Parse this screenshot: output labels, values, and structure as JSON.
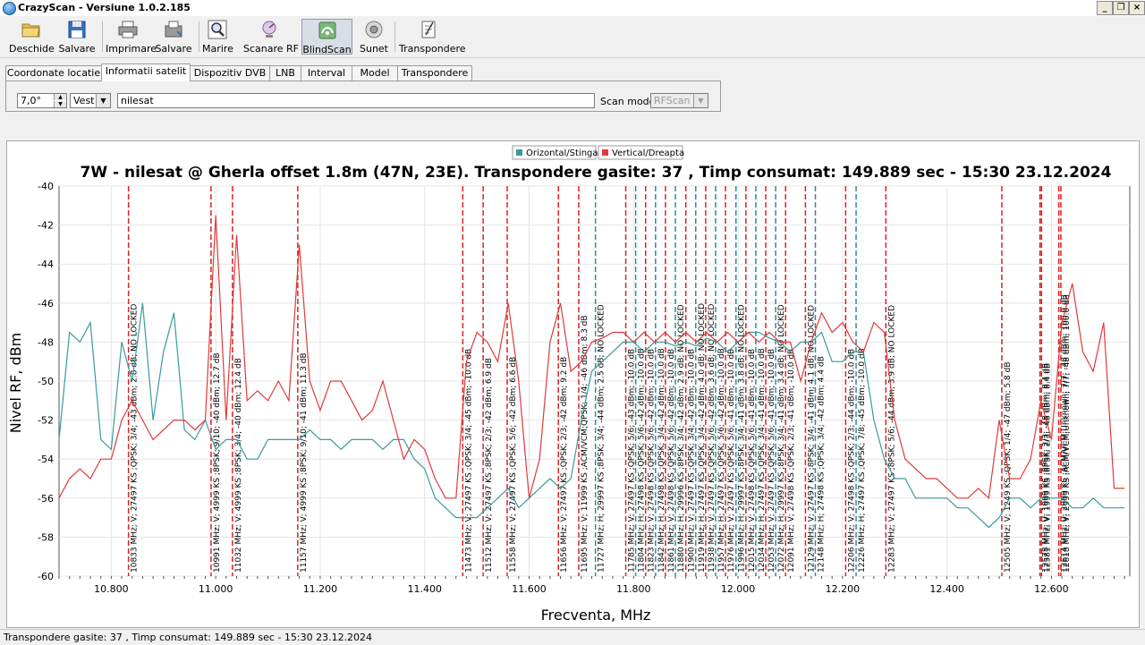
{
  "window": {
    "title": "CrazyScan - Versiune 1.0.2.185"
  },
  "toolbar": {
    "buttons": [
      {
        "label": "Deschide",
        "icon": "folder-icon"
      },
      {
        "label": "Salvare",
        "icon": "floppy-disk-icon"
      },
      {
        "label": "Imprimare",
        "icon": "printer-icon"
      },
      {
        "label": "Salvare",
        "icon": "save-image-icon"
      },
      {
        "label": "Marire",
        "icon": "zoom-icon"
      },
      {
        "label": "Scanare RF",
        "icon": "rf-scan-icon"
      },
      {
        "label": "BlindScan",
        "icon": "blindscan-icon"
      },
      {
        "label": "Sunet",
        "icon": "speaker-icon"
      },
      {
        "label": "Transpondere",
        "icon": "notepad-icon"
      }
    ]
  },
  "tabs": [
    "Coordonate locatie",
    "Informatii satelit",
    "Dispozitiv DVB",
    "LNB",
    "Interval",
    "Model",
    "Transpondere"
  ],
  "active_tab": 1,
  "satellite": {
    "position_value": "7,0°",
    "direction_value": "Vest",
    "name_value": "nilesat",
    "scan_mode_label": "Scan mode",
    "scan_mode_value": "RFScan"
  },
  "status_bar": {
    "text": "Transpondere gasite: 37 , Timp consumat: 149.889 sec - 15:30 23.12.2024"
  },
  "colors": {
    "horizontal": "#3a9a9a",
    "vertical": "#e03a3a",
    "tp_vertical": "#e02020",
    "tp_horizontal": "#2a9090"
  },
  "chart_data": {
    "type": "line",
    "title": "7W - nilesat @ Gherla offset 1.8m (47N, 23E). Transpondere gasite: 37 , Timp consumat: 149.889 sec - 15:30 23.12.2024",
    "xlabel": "Frecventa, MHz",
    "ylabel": "Nivel RF, dBm",
    "xlim": [
      10700,
      12750
    ],
    "ylim": [
      -60,
      -40
    ],
    "x_ticks": [
      "10.800",
      "11.000",
      "11.200",
      "11.400",
      "11.600",
      "11.800",
      "12.000",
      "12.200",
      "12.400",
      "12.600"
    ],
    "x_tick_values": [
      10800,
      11000,
      11200,
      11400,
      11600,
      11800,
      12000,
      12200,
      12400,
      12600
    ],
    "y_ticks": [
      -40,
      -42,
      -44,
      -46,
      -48,
      -50,
      -52,
      -54,
      -56,
      -58,
      -60
    ],
    "grid": true,
    "legend_position": "top-center",
    "series": [
      {
        "name": "Orizontal/Stinga",
        "x": [
          10700,
          10720,
          10740,
          10760,
          10780,
          10800,
          10820,
          10840,
          10860,
          10880,
          10900,
          10920,
          10940,
          10960,
          10980,
          11000,
          11020,
          11040,
          11060,
          11080,
          11100,
          11120,
          11140,
          11160,
          11180,
          11200,
          11220,
          11240,
          11260,
          11280,
          11300,
          11320,
          11340,
          11360,
          11380,
          11400,
          11420,
          11440,
          11460,
          11480,
          11500,
          11520,
          11540,
          11560,
          11580,
          11600,
          11620,
          11640,
          11660,
          11680,
          11700,
          11720,
          11740,
          11760,
          11780,
          11800,
          11820,
          11840,
          11860,
          11880,
          11900,
          11920,
          11940,
          11960,
          11980,
          12000,
          12020,
          12040,
          12060,
          12080,
          12100,
          12120,
          12140,
          12160,
          12180,
          12200,
          12220,
          12240,
          12260,
          12280,
          12300,
          12320,
          12340,
          12360,
          12380,
          12400,
          12420,
          12440,
          12460,
          12480,
          12500,
          12520,
          12540,
          12560,
          12580,
          12600,
          12620,
          12640,
          12660,
          12680,
          12700,
          12720,
          12740
        ],
        "y": [
          -53,
          -47.5,
          -48,
          -47,
          -53,
          -53.5,
          -48,
          -50,
          -46,
          -52,
          -48.5,
          -46.5,
          -52.5,
          -53,
          -52,
          -53.5,
          -53,
          -53,
          -54,
          -54,
          -53,
          -53,
          -53,
          -53,
          -52.5,
          -53,
          -53,
          -53.5,
          -53,
          -53,
          -53,
          -53.5,
          -53,
          -53,
          -54,
          -54.5,
          -56,
          -56.5,
          -57,
          -57,
          -57,
          -56.5,
          -56,
          -55.5,
          -56.5,
          -56,
          -55.5,
          -55,
          -55.5,
          -55,
          -52,
          -49.5,
          -49,
          -48.5,
          -48,
          -48,
          -48.5,
          -48,
          -48,
          -48.2,
          -48,
          -48.2,
          -47.8,
          -48,
          -48.5,
          -48,
          -47.5,
          -47.5,
          -47.8,
          -48,
          -48.5,
          -48,
          -48,
          -47.5,
          -49,
          -49,
          -48.5,
          -48.5,
          -52,
          -54,
          -55,
          -55,
          -56,
          -56,
          -56,
          -56,
          -56.5,
          -56.5,
          -57,
          -57.5,
          -57,
          -56,
          -56,
          -56.5,
          -56,
          -56,
          -56,
          -56.5,
          -56.5,
          -56,
          -56.5,
          -56.5,
          -56.5
        ]
      },
      {
        "name": "Vertical/Dreapta",
        "x": [
          10700,
          10720,
          10740,
          10760,
          10780,
          10800,
          10820,
          10840,
          10860,
          10880,
          10900,
          10920,
          10940,
          10960,
          10980,
          11000,
          11020,
          11040,
          11060,
          11080,
          11100,
          11120,
          11140,
          11160,
          11180,
          11200,
          11220,
          11240,
          11260,
          11280,
          11300,
          11320,
          11340,
          11360,
          11380,
          11400,
          11420,
          11440,
          11460,
          11480,
          11500,
          11520,
          11540,
          11560,
          11580,
          11600,
          11620,
          11640,
          11660,
          11680,
          11700,
          11720,
          11740,
          11760,
          11780,
          11800,
          11820,
          11840,
          11860,
          11880,
          11900,
          11920,
          11940,
          11960,
          11980,
          12000,
          12020,
          12040,
          12060,
          12080,
          12100,
          12120,
          12140,
          12160,
          12180,
          12200,
          12220,
          12240,
          12260,
          12280,
          12300,
          12320,
          12340,
          12360,
          12380,
          12400,
          12420,
          12440,
          12460,
          12480,
          12500,
          12520,
          12540,
          12560,
          12580,
          12600,
          12620,
          12640,
          12660,
          12680,
          12700,
          12720,
          12740
        ],
        "y": [
          -56,
          -55,
          -54.5,
          -55,
          -54,
          -54,
          -52,
          -51,
          -52,
          -53,
          -52.5,
          -52,
          -52,
          -52.5,
          -52,
          -41.5,
          -52,
          -42.5,
          -51,
          -50.5,
          -51,
          -50,
          -51,
          -43,
          -50,
          -51.5,
          -50,
          -50,
          -51,
          -52,
          -51.5,
          -50,
          -52,
          -54,
          -53,
          -53.5,
          -55,
          -56,
          -56,
          -49,
          -47.5,
          -48,
          -49,
          -46,
          -50,
          -56,
          -54,
          -48,
          -46,
          -49.5,
          -49,
          -48,
          -47.8,
          -47.5,
          -47.5,
          -48,
          -47.5,
          -48,
          -47.5,
          -48,
          -47.5,
          -48,
          -47.5,
          -48,
          -47.5,
          -48,
          -47.5,
          -48,
          -47.5,
          -48,
          -48,
          -50,
          -48,
          -46.5,
          -47.5,
          -47,
          -48,
          -48.5,
          -47,
          -47.5,
          -52,
          -54,
          -54.5,
          -55,
          -55,
          -55.5,
          -56,
          -56,
          -55.5,
          -56,
          -52,
          -55,
          -55,
          -54,
          -51,
          -53,
          -47,
          -45,
          -48.5,
          -49.5,
          -47,
          -55.5,
          -55.5
        ]
      }
    ],
    "transponders": [
      {
        "freq": 10833,
        "pol": "V",
        "label": "10833 MHz; V; 27497 KS ;QPSK; 3/4; -43 dBm; 2.8 dB; NO LOCKED"
      },
      {
        "freq": 10991,
        "pol": "V",
        "label": "10991 MHz; V; 4999 KS ;8PSK; 9/10; -40 dBm; 12.7 dB"
      },
      {
        "freq": 11032,
        "pol": "V",
        "label": "11032 MHz; V; 4999 KS ;8PSK; 3/4; -40 dBm; 12.4 dB"
      },
      {
        "freq": 11157,
        "pol": "V",
        "label": "11157 MHz; V; 4999 KS ;8PSK; 9/10; -41 dBm; 11.3 dB"
      },
      {
        "freq": 11473,
        "pol": "V",
        "label": "11473 MHz; V; 27497 KS ;QPSK; 3/4; -45 dBm; -10.0 dB"
      },
      {
        "freq": 11512,
        "pol": "V",
        "label": "11512 MHz; V; 27497 KS ;8PSK; 2/3; -42 dBm; 6.9 dB"
      },
      {
        "freq": 11558,
        "pol": "V",
        "label": "11558 MHz; V; 27497 KS ;QPSK; 5/6; -42 dBm; 6.6 dB"
      },
      {
        "freq": 11656,
        "pol": "V",
        "label": "11656 MHz; V; 27497 KS ;QPSK; 2/3; -42 dBm; 9.2 dB"
      },
      {
        "freq": 11695,
        "pol": "V",
        "label": "11695 MHz; V; 11999 KS ;ACM/VCM;QPSK; 1/4; -46 dBm; 8.3 dB"
      },
      {
        "freq": 11727,
        "pol": "H",
        "label": "11727 MHz; H; 29997 KS ;8PSK; 3/4; -44 dBm; 2.5 dB; NO LOCKED"
      },
      {
        "freq": 11785,
        "pol": "V",
        "label": "11785 MHz; V; 27497 KS ;QPSK; 5/6; -43 dBm; -10.0 dB"
      },
      {
        "freq": 11804,
        "pol": "H",
        "label": "11804 MHz; H; 27498 KS ;QPSK; 5/6; -42 dBm; -10.0 dB"
      },
      {
        "freq": 11823,
        "pol": "V",
        "label": "11823 MHz; V; 27498 KS ;QPSK; 5/6; -42 dBm; -10.0 dB"
      },
      {
        "freq": 11842,
        "pol": "H",
        "label": "11842 MHz; H; 27498 KS ;QPSK; 3/4; -42 dBm; -10.0 dB"
      },
      {
        "freq": 11861,
        "pol": "V",
        "label": "11861 MHz; V; 27498 KS ;QPSK; 5/6; -42 dBm; -10.0 dB"
      },
      {
        "freq": 11880,
        "pol": "H",
        "label": "11880 MHz; H; 29996 KS ;8PSK; 3/4; -42 dBm; 2.9 dB; NO LOCKED"
      },
      {
        "freq": 11900,
        "pol": "V",
        "label": "11900 MHz; V; 27497 KS ;QPSK; 3/4; -42 dBm; -10.0 dB"
      },
      {
        "freq": 11919,
        "pol": "H",
        "label": "11919 MHz; H; 27497 KS ;QPSK; 3/4; -42 dBm; 4.0 dB; NO LOCKED"
      },
      {
        "freq": 11938,
        "pol": "V",
        "label": "11938 MHz; V; 27497 KS ;QPSK; 5/6; -42 dBm; 3.6 dB; NO LOCKED"
      },
      {
        "freq": 11957,
        "pol": "H",
        "label": "11957 MHz; H; 27497 KS ;QPSK; 5/6; -42 dBm; -10.0 dB"
      },
      {
        "freq": 11976,
        "pol": "V",
        "label": "11976 MHz; V; 27497 KS ;QPSK; 5/6; -41 dBm; -10.0 dB"
      },
      {
        "freq": 11996,
        "pol": "H",
        "label": "11996 MHz; H; 29997 KS ;8PSK; 3/4; -41 dBm; 3.8 dB; NO LOCKED"
      },
      {
        "freq": 12015,
        "pol": "V",
        "label": "12015 MHz; V; 27498 KS ;QPSK; 5/6; -41 dBm; -10.0 dB"
      },
      {
        "freq": 12034,
        "pol": "H",
        "label": "12034 MHz; H; 27497 KS ;QPSK; 3/4; -41 dBm; -10.0 dB"
      },
      {
        "freq": 12053,
        "pol": "V",
        "label": "12053 MHz; V; 27497 KS ;QPSK; 5/6; -41 dBm; -10.0 dB"
      },
      {
        "freq": 12072,
        "pol": "H",
        "label": "12072 MHz; H; 29997 KS ;8PSK; 3/4; -41 dBm; 3.4 dB; NO LOCKED"
      },
      {
        "freq": 12091,
        "pol": "V",
        "label": "12091 MHz; V; 27498 KS ;QPSK; 2/3; -41 dBm; -10.0 dB"
      },
      {
        "freq": 12129,
        "pol": "V",
        "label": "12129 MHz; V; 27497 KS ;8PSK; 3/4; -41 dBm; 4.1 dB; NO LOCKED"
      },
      {
        "freq": 12148,
        "pol": "H",
        "label": "12148 MHz; H; 27498 KS ;QPSK; 3/4; -42 dBm; 4.4 dB"
      },
      {
        "freq": 12206,
        "pol": "V",
        "label": "12206 MHz; V; 27498 KS ;QPSK; 2/3; -44 dBm; -10.0 dB"
      },
      {
        "freq": 12226,
        "pol": "H",
        "label": "12226 MHz; H; 27497 KS ;QPSK; 7/8; -45 dBm; -10.0 dB"
      },
      {
        "freq": 12283,
        "pol": "V",
        "label": "12283 MHz; V; 27497 KS ;8PSK; 5/6; -44 dBm; 3.9 dB; NO LOCKED"
      },
      {
        "freq": 12505,
        "pol": "V",
        "label": "12505 MHz; V; 1249 KS ;QPSK; 1/4; -47 dBm; 5.8 dB"
      },
      {
        "freq": 12578,
        "pol": "V",
        "label": "12578 MHz; V; 1999 KS ;8PSK; 2/3; -48 dBm; 8.4 dB"
      },
      {
        "freq": 12581,
        "pol": "V",
        "label": "12581 MHz; V; 1999 KS ;8PSK; 2/3; -48 dBm; 8.4 dB"
      },
      {
        "freq": 12614,
        "pol": "V",
        "label": "12614 MHz; V; 2999 KS ;ACM/VCM;Unknown; 7/7; -48 dBm; 100.0 dB"
      },
      {
        "freq": 12618,
        "pol": "V",
        "label": "12618 MHz; V; 2999 KS ;ACM/VCM;Unknown; 7/7; -48 dBm; 100.0 dB"
      }
    ]
  }
}
